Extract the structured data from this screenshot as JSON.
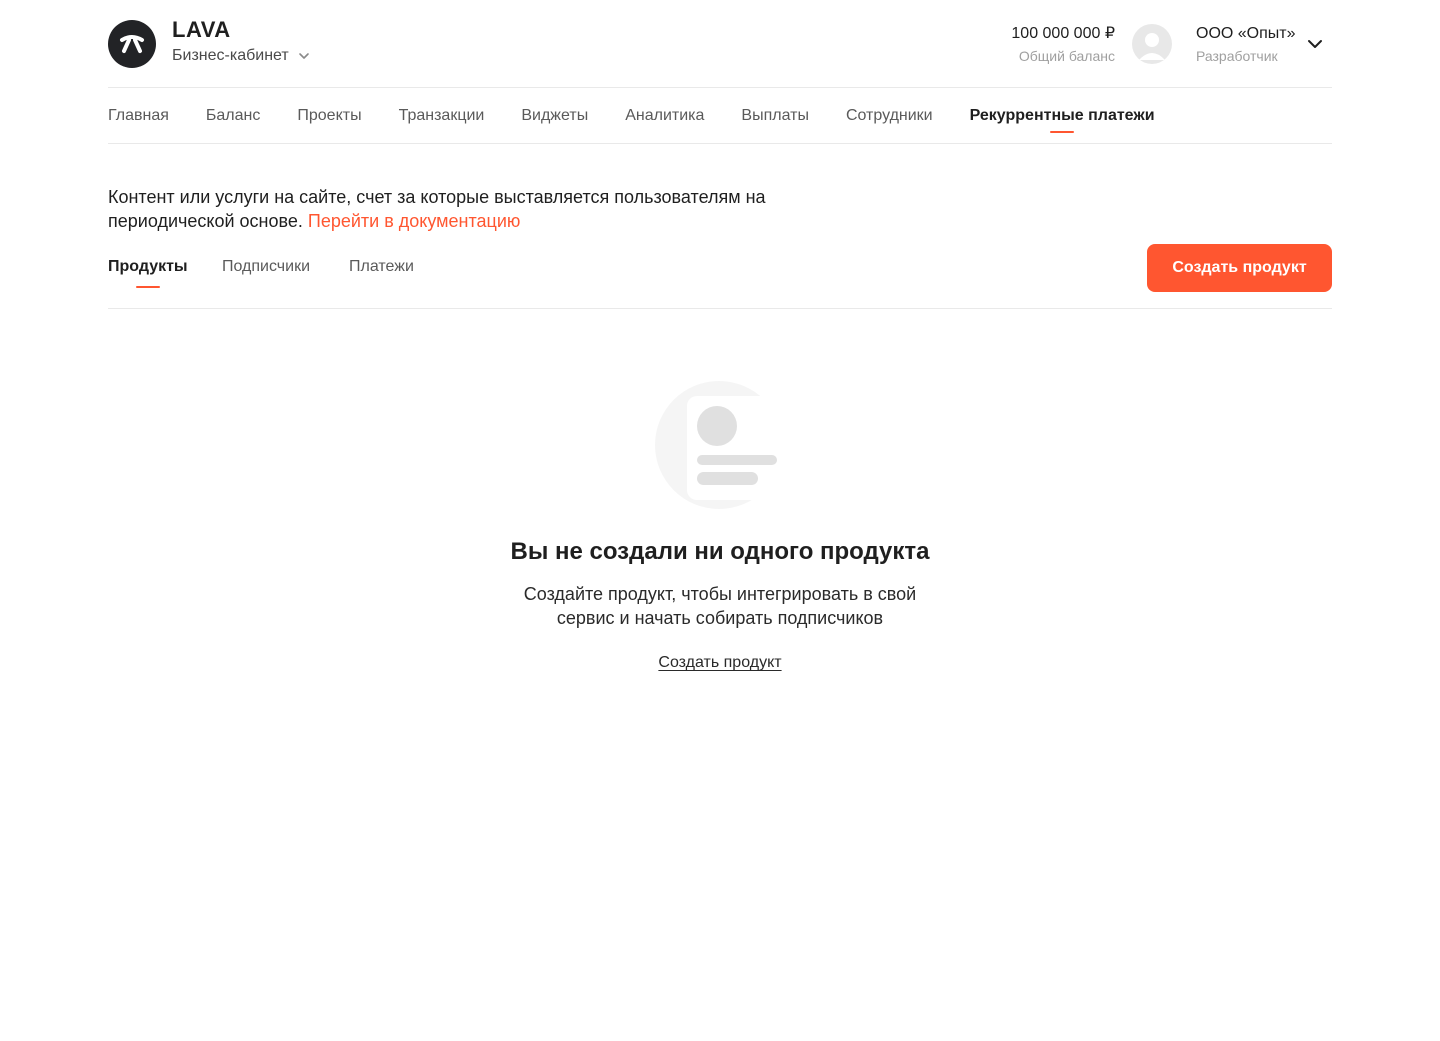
{
  "brand": {
    "name": "LAVA",
    "cabinet_label": "Бизнес-кабинет",
    "logo_icon": "lava-logo-icon"
  },
  "header": {
    "balance_amount": "100 000 000 ₽",
    "balance_label": "Общий баланс",
    "company_name": "ООО «Опыт»",
    "company_role": "Разработчик"
  },
  "nav": {
    "items": [
      {
        "label": "Главная",
        "active": false
      },
      {
        "label": "Баланс",
        "active": false
      },
      {
        "label": "Проекты",
        "active": false
      },
      {
        "label": "Транзакции",
        "active": false
      },
      {
        "label": "Виджеты",
        "active": false
      },
      {
        "label": "Аналитика",
        "active": false
      },
      {
        "label": "Выплаты",
        "active": false
      },
      {
        "label": "Сотрудники",
        "active": false
      },
      {
        "label": "Рекуррентные платежи",
        "active": true
      }
    ]
  },
  "description": {
    "text": "Контент или услуги на сайте, счет за которые выставляется пользователям на периодической основе.",
    "link": "Перейти в документацию"
  },
  "subtabs": {
    "items": [
      {
        "label": "Продукты",
        "active": true
      },
      {
        "label": "Подписчики",
        "active": false
      },
      {
        "label": "Платежи",
        "active": false
      }
    ],
    "create_button": "Создать продукт"
  },
  "empty_state": {
    "title": "Вы не создали ни одного продукта",
    "text": "Создайте продукт, чтобы интегрировать в свой сервис и начать собирать подписчиков",
    "link": "Создать продукт"
  },
  "colors": {
    "accent": "#ff5630",
    "text": "#1f1f1f",
    "muted": "#a0a0a0",
    "divider": "#e9e9e9"
  }
}
